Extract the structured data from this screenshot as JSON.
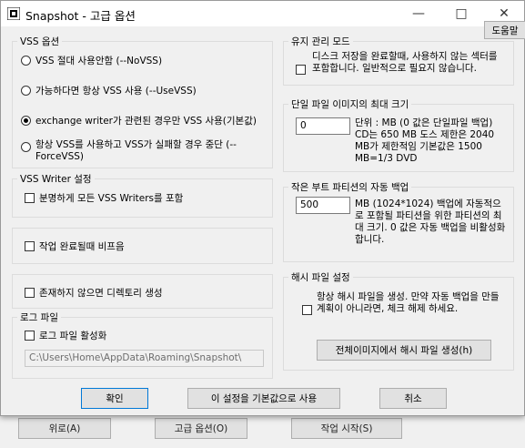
{
  "background_window": {
    "buttons": [
      "위로(A)",
      "고급 옵션(O)",
      "작업 시작(S)"
    ]
  },
  "window": {
    "title": "Snapshot - 고급 옵션",
    "minimize_icon": "minimize-icon",
    "maximize_icon": "maximize-icon",
    "close_icon": "close-icon",
    "help_label": "도움말"
  },
  "vss": {
    "legend": "VSS 옵션",
    "options": [
      {
        "label": "VSS 절대 사용안함 (--NoVSS)",
        "selected": false
      },
      {
        "label": "가능하다면 항상 VSS 사용 (--UseVSS)",
        "selected": false
      },
      {
        "label": "exchange writer가 관련된 경우만 VSS 사용(기본값)",
        "selected": true
      },
      {
        "label": "항상 VSS를 사용하고 VSS가 실패할 경우 중단 (--ForceVSS)",
        "selected": false
      }
    ]
  },
  "vss_writer": {
    "legend": "VSS Writer 설정",
    "label": "분명하게 모든 VSS Writers를 포함",
    "checked": false
  },
  "beep": {
    "label": "작업 완료될때 비프음",
    "checked": false
  },
  "create_dir": {
    "label": "존재하지 않으면 디렉토리 생성",
    "checked": false
  },
  "log": {
    "legend": "로그 파일",
    "label": "로그 파일 활성화",
    "checked": false,
    "path": "C:\\Users\\Home\\AppData\\Roaming\\Snapshot\\"
  },
  "maintenance": {
    "legend": "유지 관리 모드",
    "label": "디스크 저장을 완료할때, 사용하지 않는 섹터를 포함합니다. 일반적으로 필요지 않습니다.",
    "checked": false
  },
  "max_size": {
    "legend": "단일 파일 이미지의 최대 크기",
    "value": "0",
    "description": "단위 : MB (0 값은 단일파일 백업) CD는 650 MB 도스 제한은 2040 MB가 제한적임 기본값은 1500 MB=1/3 DVD"
  },
  "boot": {
    "legend": "작은 부트 파티션의 자동 백업",
    "value": "500",
    "description": "MB (1024*1024) 백업에 자동적으로 포함될 파티션을 위한 파티션의 최대 크기. 0 값은 자동 백업을 비활성화 합니다."
  },
  "hash": {
    "legend": "해시 파일 설정",
    "label": "항상 해시 파일을 생성. 만약 자동 백업을 만들 계획이 아니라면, 체크 해제 하세요.",
    "checked": false,
    "button": "전체이미지에서 해시 파일 생성(h)"
  },
  "footer": {
    "ok": "확인",
    "reset": "이 설정을 기본값으로 사용",
    "cancel": "취소"
  }
}
